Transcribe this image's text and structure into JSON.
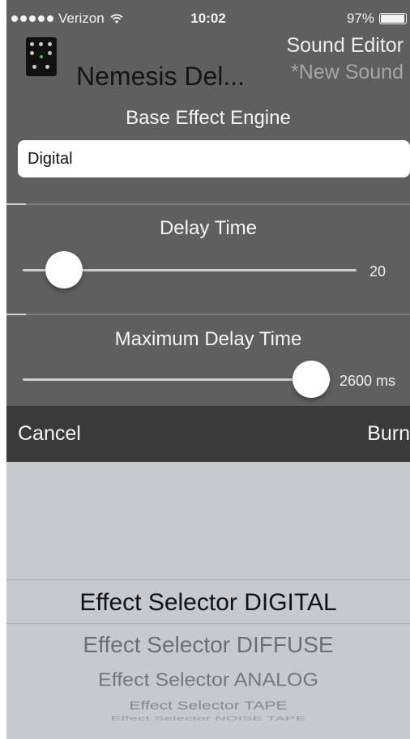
{
  "status_bar": {
    "carrier": "Verizon",
    "time": "10:02",
    "battery": "97%",
    "battery_level": 0.97
  },
  "header": {
    "device_name": "Nemesis Del...",
    "editor_title": "Sound Editor",
    "sound_name": "*New Sound"
  },
  "base_engine": {
    "label": "Base Effect Engine",
    "value": "Digital"
  },
  "delay_time": {
    "label": "Delay Time",
    "value": "20"
  },
  "max_delay_time": {
    "label": "Maximum Delay Time",
    "value": "2600 ms"
  },
  "toolbar": {
    "cancel_label": "Cancel",
    "burn_label": "Burn"
  },
  "picker": {
    "options": [
      "Effect Selector DIGITAL",
      "Effect Selector DIFFUSE",
      "Effect Selector ANALOG",
      "Effect Selector TAPE",
      "Effect Selector NOISE TAPE"
    ],
    "selected": "Effect Selector DIGITAL"
  },
  "colors": {
    "panel_bg": "#5f5f5f",
    "toolbar_bg": "#3a3a3a",
    "picker_bg": "#c6c9ce"
  }
}
